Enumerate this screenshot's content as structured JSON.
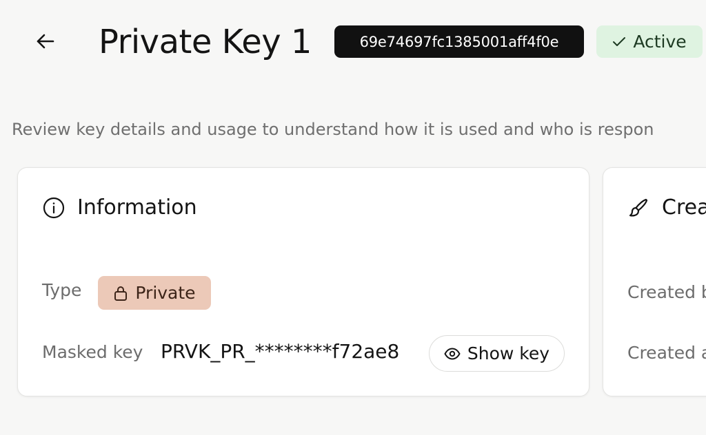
{
  "header": {
    "back_icon": "arrow-left-icon",
    "title": "Private Key 1",
    "key_id": "69e74697fc1385001aff4f0e",
    "status": {
      "label": "Active",
      "icon": "check-icon",
      "color": "#dff3e1"
    }
  },
  "subtitle": "Review key details and usage to understand how it is used and who is respon",
  "information_card": {
    "title": "Information",
    "icon": "info-icon",
    "type_label": "Type",
    "type_value": "Private",
    "type_icon": "lock-icon",
    "type_color": "#ecc9b8",
    "masked_key_label": "Masked key",
    "masked_key_value": "PRVK_PR_********f72ae8",
    "show_key_label": "Show key",
    "show_key_icon": "eye-icon"
  },
  "creation_card": {
    "title": "Crea",
    "icon": "brush-icon",
    "created_by_label": "Created b",
    "created_at_label": "Created a"
  }
}
